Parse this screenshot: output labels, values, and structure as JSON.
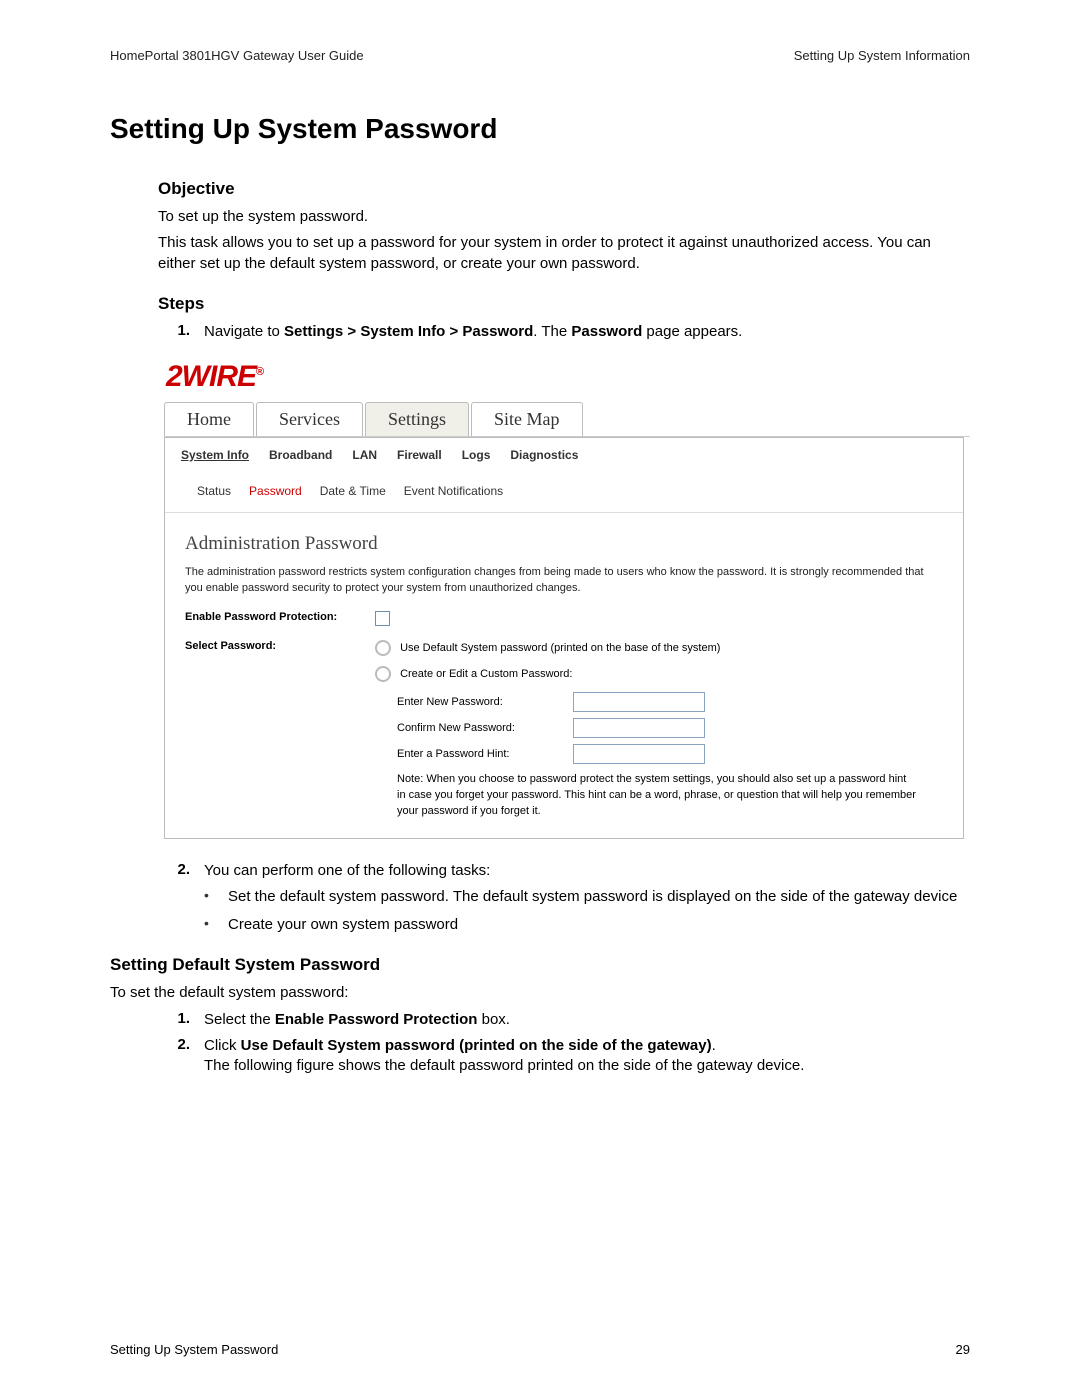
{
  "header": {
    "left": "HomePortal 3801HGV Gateway User Guide",
    "right": "Setting Up System Information"
  },
  "title": "Setting Up System Password",
  "objective": {
    "heading": "Objective",
    "p1": "To set up the system password.",
    "p2": "This task allows you to set up a password for your system in order to protect it against unauthorized access. You can either set up the default system password, or create your own password."
  },
  "steps": {
    "heading": "Steps",
    "items": [
      {
        "num": "1.",
        "pre": "Navigate to ",
        "bold": "Settings > System Info > Password",
        "mid": ". The ",
        "bold2": "Password",
        "post": " page appears."
      }
    ]
  },
  "ui": {
    "logo": "2WIRE",
    "maintabs": [
      "Home",
      "Services",
      "Settings",
      "Site Map"
    ],
    "maintab_active_index": 2,
    "subtabs": [
      "System Info",
      "Broadband",
      "LAN",
      "Firewall",
      "Logs",
      "Diagnostics"
    ],
    "subtab_selected_index": 0,
    "tertiary": [
      "Status",
      "Password",
      "Date & Time",
      "Event Notifications"
    ],
    "tertiary_selected_index": 1,
    "admin": {
      "heading": "Administration Password",
      "desc": "The administration password restricts system configuration changes from being made to users who know the password. It is strongly recommended that you enable password security to protect your system from unauthorized changes.",
      "enable_label": "Enable Password Protection:",
      "select_label": "Select Password:",
      "opt1": "Use Default System password (printed on the base of the system)",
      "opt2": "Create or Edit a Custom Password:",
      "field1": "Enter New Password:",
      "field2": "Confirm New Password:",
      "field3": "Enter a Password Hint:",
      "note": "Note: When you choose to password protect the system settings, you should also set up a password hint in case you forget your password. This hint can be a word, phrase, or question that will help you remember your password if you forget it."
    }
  },
  "after": {
    "step2": {
      "num": "2.",
      "text": "You can perform one of the following tasks:"
    },
    "bullets": [
      "Set the default system password. The default system password is displayed on the side of the gateway device",
      "Create your own system password"
    ]
  },
  "defaultSection": {
    "heading": "Setting Default System Password",
    "p1": "To set the default system password:",
    "steps": [
      {
        "num": "1.",
        "pre": "Select the ",
        "bold": "Enable Password Protection",
        "post": " box."
      },
      {
        "num": "2.",
        "pre": "Click ",
        "bold": "Use Default System password (printed on the side of the gateway)",
        "post": ".",
        "line2": "The following figure shows the default password printed on the side of the gateway device."
      }
    ]
  },
  "footer": {
    "left": "Setting Up System Password",
    "right": "29"
  }
}
